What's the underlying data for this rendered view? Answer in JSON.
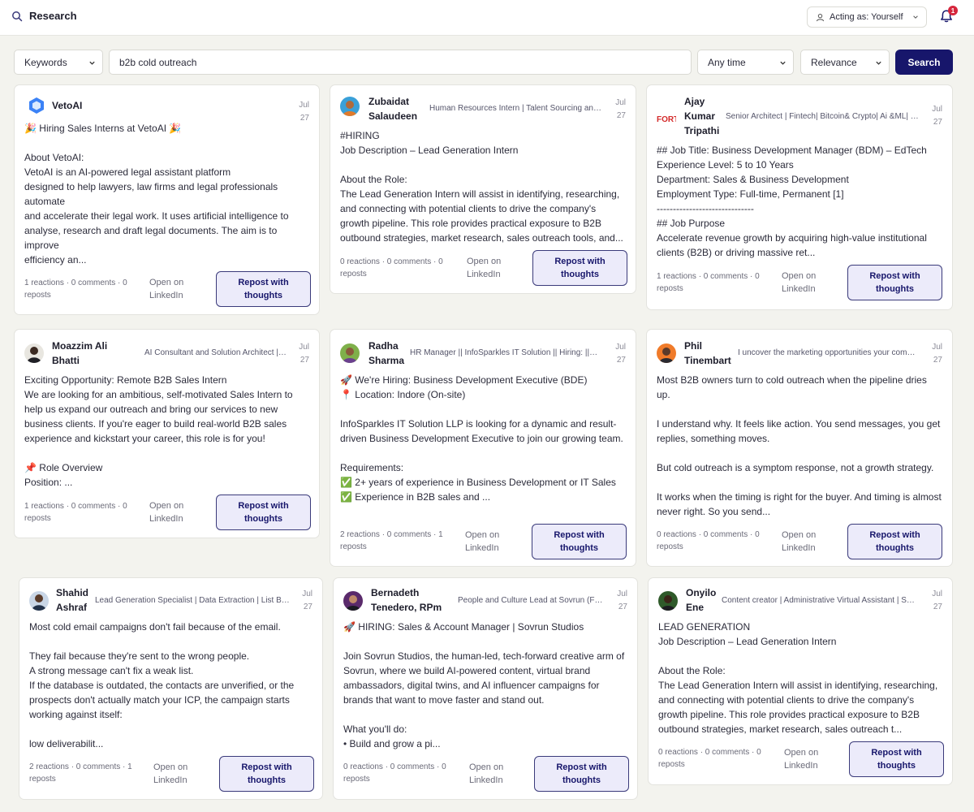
{
  "header": {
    "title": "Research",
    "acting_as": "Acting as: Yourself",
    "notification_count": "1"
  },
  "search": {
    "type": "Keywords",
    "query": "b2b cold outreach",
    "time": "Any time",
    "sort": "Relevance",
    "button": "Search"
  },
  "colors": {
    "accent": "#17166b",
    "background": "#f3f3ee",
    "repost_bg": "#ecebfa",
    "badge": "#d6263c"
  },
  "action_labels": {
    "open": "Open on LinkedIn",
    "repost": "Repost with thoughts"
  },
  "posts": [
    {
      "name": "VetoAI",
      "headline": "",
      "date": "Jul 27",
      "body": "🎉 Hiring Sales Interns at VetoAI 🎉\n\nAbout VetoAI:\nVetoAI is an AI-powered legal assistant platform\n designed to help lawyers, law firms and legal professionals automate\nand accelerate their legal work. It uses artificial intelligence to analyse, research and draft legal documents. The aim is to improve\nefficiency an...",
      "stats": "1 reactions · 0 comments · 0 reposts",
      "avatar_icon": "hexagon-logo-icon"
    },
    {
      "name": "Zubaidat Salaudeen",
      "headline": "Human Resources Intern | Talent Sourcing and Recruitment",
      "date": "Jul 27",
      "body": "#HIRING\nJob Description – Lead Generation Intern\n\nAbout the Role:\nThe Lead Generation Intern will assist in identifying, researching, and connecting with potential clients to drive the company's growth pipeline. This role provides practical exposure to B2B outbound strategies, market research, sales outreach tools, and...",
      "stats": "0 reactions · 0 comments · 0 reposts",
      "avatar_icon": "person-photo-icon"
    },
    {
      "name": "Ajay Kumar Tripathi",
      "headline": "Senior Architect | Fintech| Bitcoin& Crypto| Ai &ML| Blockchain",
      "date": "Jul 27",
      "body": "## Job Title: Business Development Manager (BDM) – EdTech\nExperience Level: 5 to 10 Years\nDepartment: Sales & Business Development\nEmployment Type: Full-time, Permanent [1]\n------------------------------\n## Job Purpose\nAccelerate revenue growth by acquiring high-value institutional clients (B2B) or driving massive ret...",
      "stats": "1 reactions · 0 comments · 0 reposts",
      "avatar_icon": "fort-logo-icon"
    },
    {
      "name": "Moazzim Ali Bhatti",
      "headline": "AI Consultant and Solution Architect | Automation",
      "date": "Jul 27",
      "body": "Exciting Opportunity: Remote B2B Sales Intern\nWe are looking for an ambitious, self-motivated Sales Intern to help us expand our outreach and bring our services to new business clients. If you're eager to build real-world B2B sales experience and kickstart your career, this role is for you!\n\n📌 Role Overview\nPosition: ...",
      "stats": "1 reactions · 0 comments · 0 reposts",
      "avatar_icon": "person-photo-icon"
    },
    {
      "name": "Radha Sharma",
      "headline": "HR Manager || InfoSparkles IT Solution || Hiring: ||Linkedin",
      "date": "Jul 27",
      "body": "🚀 We're Hiring: Business Development Executive (BDE)\n📍 Location: Indore (On-site)\n\nInfoSparkles IT Solution LLP is looking for a dynamic and result-driven Business Development Executive to join our growing team.\n\nRequirements:\n✅ 2+ years of experience in Business Development or IT Sales\n✅ Experience in B2B sales and ...",
      "stats": "2 reactions · 0 comments · 1 reposts",
      "avatar_icon": "person-photo-icon"
    },
    {
      "name": "Phil Tinembart",
      "headline": "I uncover the marketing opportunities your competitors miss",
      "date": "Jul 27",
      "body": "Most B2B owners turn to cold outreach when the pipeline dries up.\n\nI understand why. It feels like action. You send messages, you get replies, something moves.\n\nBut cold outreach is a symptom response, not a growth strategy.\n\nIt works when the timing is right for the buyer. And timing is almost never right. So you send...",
      "stats": "0 reactions · 0 comments · 0 reposts",
      "avatar_icon": "person-photo-icon"
    },
    {
      "name": "Shahid Ashraf",
      "headline": "Lead Generation Specialist | Data Extraction | List Building",
      "date": "Jul 27",
      "body": "Most cold email campaigns don't fail because of the email.\n\nThey fail because they're sent to the wrong people.\nA strong message can't fix a weak list.\nIf the database is outdated, the contacts are unverified, or the prospects don't actually match your ICP, the campaign starts working against itself:\n\nlow deliverabilit...",
      "stats": "2 reactions · 0 comments · 1 reposts",
      "avatar_icon": "person-photo-icon"
    },
    {
      "name": "Bernadeth Tenedero, RPm",
      "headline": "People and Culture Lead at Sovrun (Formerly)",
      "date": "Jul 27",
      "body": "🚀 HIRING: Sales & Account Manager | Sovrun Studios\n\nJoin Sovrun Studios, the human-led, tech-forward creative arm of Sovrun, where we build AI-powered content, virtual brand ambassadors, digital twins, and AI influencer campaigns for brands that want to move faster and stand out.\n\nWhat you'll do:\n• Build and grow a pi...",
      "stats": "0 reactions · 0 comments · 0 reposts",
      "avatar_icon": "person-photo-icon"
    },
    {
      "name": "Onyilo Ene",
      "headline": "Content creator | Administrative Virtual Assistant | Social Media",
      "date": "Jul 27",
      "body": "LEAD GENERATION\nJob Description – Lead Generation Intern\n\nAbout the Role:\nThe Lead Generation Intern will assist in identifying, researching, and connecting with potential clients to drive the company's growth pipeline. This role provides practical exposure to B2B outbound strategies, market research, sales outreach t...",
      "stats": "0 reactions · 0 comments · 0 reposts",
      "avatar_icon": "person-photo-icon"
    }
  ]
}
